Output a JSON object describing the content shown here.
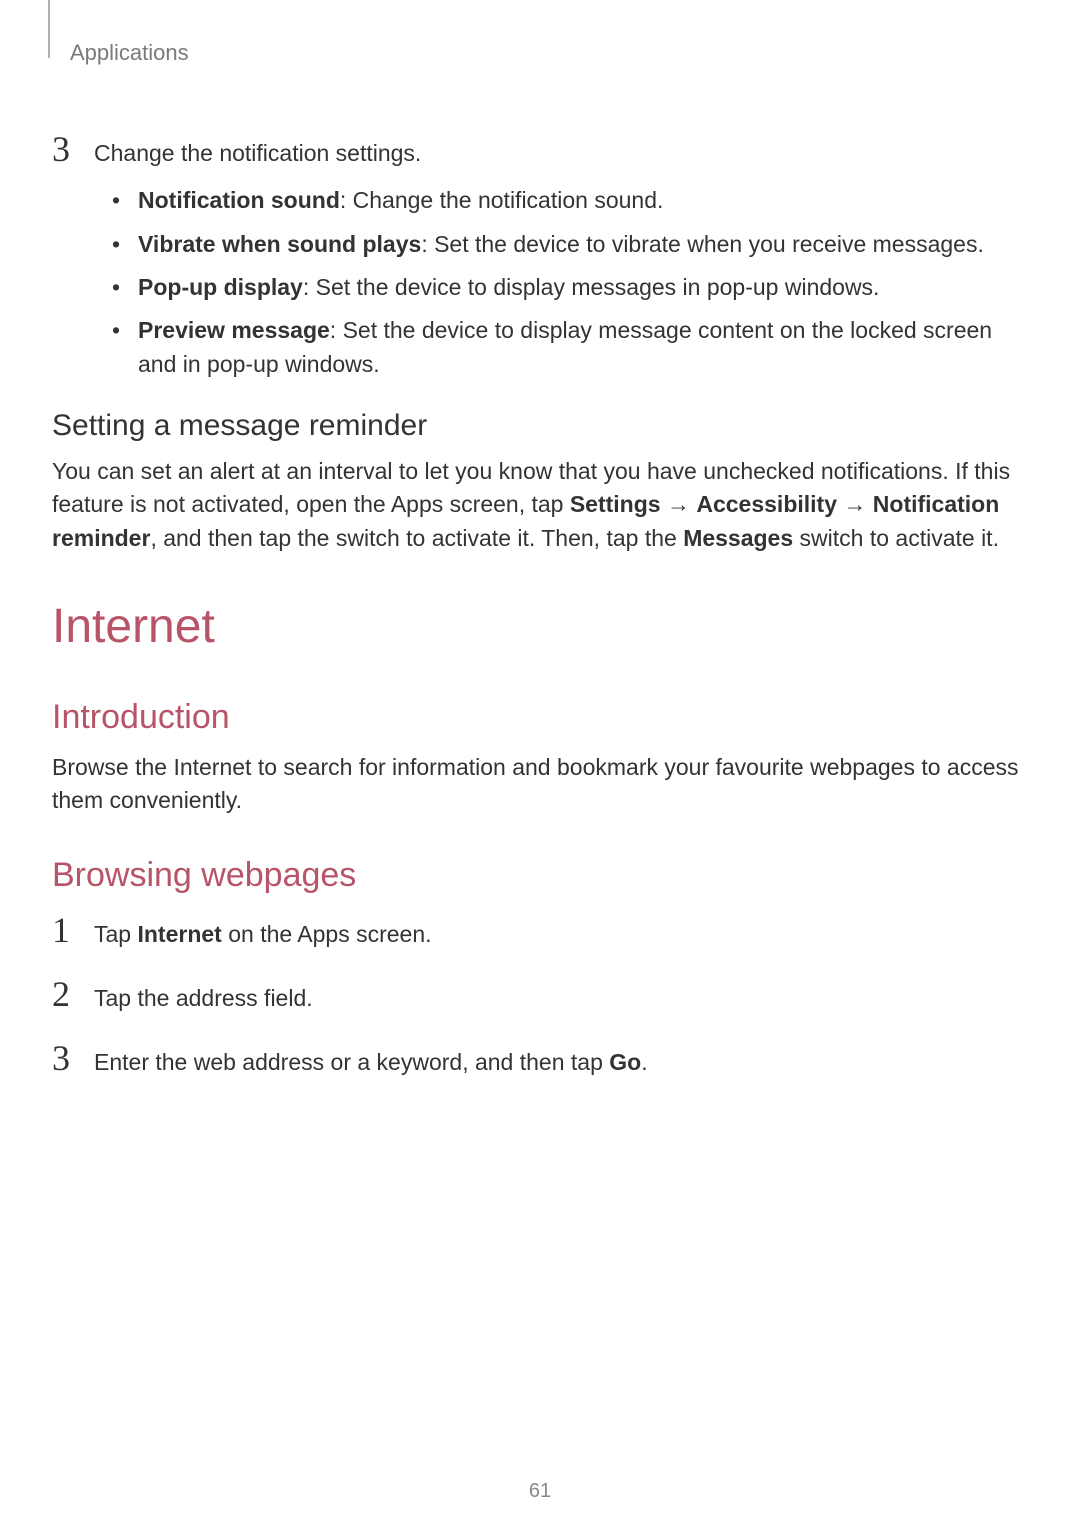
{
  "breadcrumb": "Applications",
  "step3": {
    "num": "3",
    "text": "Change the notification settings."
  },
  "bullets": [
    {
      "term": "Notification sound",
      "desc": ": Change the notification sound."
    },
    {
      "term": "Vibrate when sound plays",
      "desc": ": Set the device to vibrate when you receive messages."
    },
    {
      "term": "Pop-up display",
      "desc": ": Set the device to display messages in pop-up windows."
    },
    {
      "term": "Preview message",
      "desc": ": Set the device to display message content on the locked screen and in pop-up windows."
    }
  ],
  "reminder": {
    "heading": "Setting a message reminder",
    "p1a": "You can set an alert at an interval to let you know that you have unchecked notifications. If this feature is not activated, open the Apps screen, tap ",
    "settings": "Settings",
    "arrow": " → ",
    "accessibility": "Accessibility",
    "arrow2": " → ",
    "notifReminder": "Notification reminder",
    "p1b": ", and then tap the switch to activate it. Then, tap the ",
    "messages": "Messages",
    "p1c": " switch to activate it."
  },
  "internet": {
    "title": "Internet",
    "intro": {
      "heading": "Introduction",
      "text": "Browse the Internet to search for information and bookmark your favourite webpages to access them conveniently."
    },
    "browsing": {
      "heading": "Browsing webpages",
      "steps": [
        {
          "num": "1",
          "pre": "Tap ",
          "bold": "Internet",
          "post": " on the Apps screen."
        },
        {
          "num": "2",
          "pre": "Tap the address field.",
          "bold": "",
          "post": ""
        },
        {
          "num": "3",
          "pre": "Enter the web address or a keyword, and then tap ",
          "bold": "Go",
          "post": "."
        }
      ]
    }
  },
  "pageNumber": "61"
}
